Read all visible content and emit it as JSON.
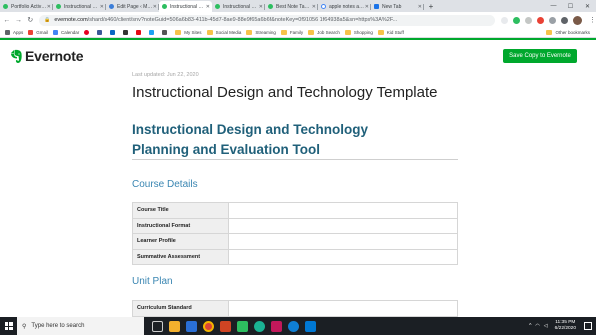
{
  "browser": {
    "tabs": [
      {
        "title": "Portfolio Activity Tr",
        "icon": "evernote-icon",
        "active": false
      },
      {
        "title": "Instructional Desig",
        "icon": "evernote-icon",
        "active": false
      },
      {
        "title": "Edit Page ‹ Moder",
        "icon": "wordpress-icon",
        "active": false
      },
      {
        "title": "Instructional Desig",
        "icon": "evernote-icon",
        "active": true
      },
      {
        "title": "Instructional Desig",
        "icon": "evernote-icon",
        "active": false
      },
      {
        "title": "Best Note Taking A",
        "icon": "evernote-icon",
        "active": false
      },
      {
        "title": "apple notes app in",
        "icon": "google-icon",
        "active": false
      },
      {
        "title": "New Tab",
        "icon": "doc-icon",
        "active": false
      }
    ],
    "new_tab_label": "+",
    "url": {
      "domain": "evernote.com",
      "path": "/shard/s460/client/snv?noteGuid=506a6b83-411b-45d7-8ae9-88e9f65a6b6f&noteKey=0f91056 1f64938a5&sn=https%3A%2F..."
    },
    "bookmarks": [
      {
        "label": "Apps",
        "kind": "apps"
      },
      {
        "label": "Gmail",
        "kind": "link"
      },
      {
        "label": "Calendar",
        "kind": "link"
      },
      {
        "label": "",
        "kind": "link"
      },
      {
        "label": "",
        "kind": "link"
      },
      {
        "label": "",
        "kind": "link"
      },
      {
        "label": "",
        "kind": "link"
      },
      {
        "label": "",
        "kind": "link"
      },
      {
        "label": "",
        "kind": "link"
      },
      {
        "label": "",
        "kind": "link"
      },
      {
        "label": "My Sites",
        "kind": "folder"
      },
      {
        "label": "Social Media",
        "kind": "folder"
      },
      {
        "label": "Streaming",
        "kind": "folder"
      },
      {
        "label": "Family",
        "kind": "folder"
      },
      {
        "label": "Job Search",
        "kind": "folder"
      },
      {
        "label": "Shopping",
        "kind": "folder"
      },
      {
        "label": "Kid Stuff",
        "kind": "folder"
      }
    ],
    "other_bookmarks_label": "Other bookmarks"
  },
  "header": {
    "logo_text": "Evernote",
    "save_button_label": "Save Copy to Evernote",
    "accent_color": "#00a82d"
  },
  "note": {
    "last_updated": "Last updated: Jun 22, 2020",
    "title": "Instructional Design and Technology Template",
    "heading_line1": "Instructional Design and Technology",
    "heading_line2": "Planning and Evaluation Tool",
    "sections": [
      {
        "title": "Course Details",
        "rows": [
          {
            "label": "Course Title",
            "value": ""
          },
          {
            "label": "Instructional Format",
            "value": ""
          },
          {
            "label": "Learner Profile",
            "value": ""
          },
          {
            "label": "Summative Assessment",
            "value": ""
          }
        ]
      },
      {
        "title": "Unit Plan",
        "rows": [
          {
            "label": "Curriculum Standard",
            "value": ""
          }
        ]
      }
    ]
  },
  "taskbar": {
    "search_placeholder": "Type here to search",
    "time": "11:35 PM",
    "date": "6/22/2020"
  }
}
